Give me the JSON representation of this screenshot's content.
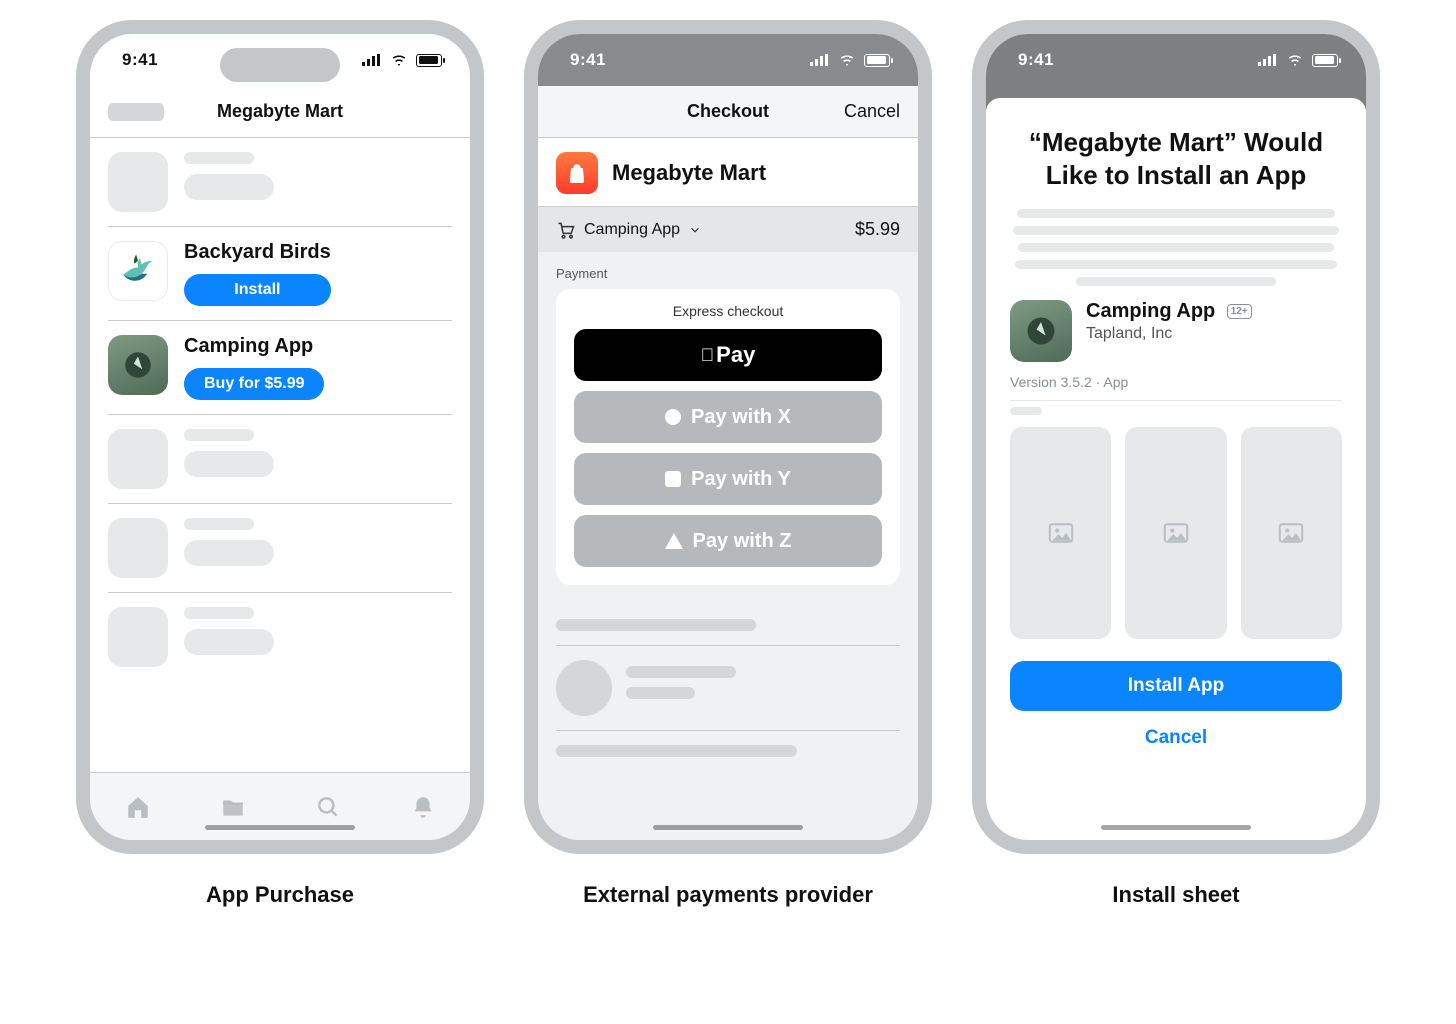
{
  "status_time": "9:41",
  "captions": {
    "p1": "App Purchase",
    "p2": "External payments provider",
    "p3": "Install sheet"
  },
  "p1": {
    "store_title": "Megabyte Mart",
    "apps": [
      {
        "name": "Backyard Birds",
        "cta": "Install"
      },
      {
        "name": "Camping App",
        "cta": "Buy for $5.99"
      }
    ]
  },
  "p2": {
    "nav_title": "Checkout",
    "nav_cancel": "Cancel",
    "store_name": "Megabyte Mart",
    "cart_item": "Camping App",
    "cart_price": "$5.99",
    "payment_label": "Payment",
    "express_label": "Express checkout",
    "apple_pay": "Pay",
    "options": [
      {
        "shape": "circle",
        "label": "Pay with X"
      },
      {
        "shape": "square",
        "label": "Pay with Y"
      },
      {
        "shape": "triangle",
        "label": "Pay with Z"
      }
    ]
  },
  "p3": {
    "title": "“Megabyte Mart” Would Like to Install an App",
    "app_name": "Camping App",
    "developer": "Tapland, Inc",
    "age_rating": "12+",
    "meta": "Version 3.5.2  ·  App",
    "install": "Install App",
    "cancel": "Cancel"
  }
}
